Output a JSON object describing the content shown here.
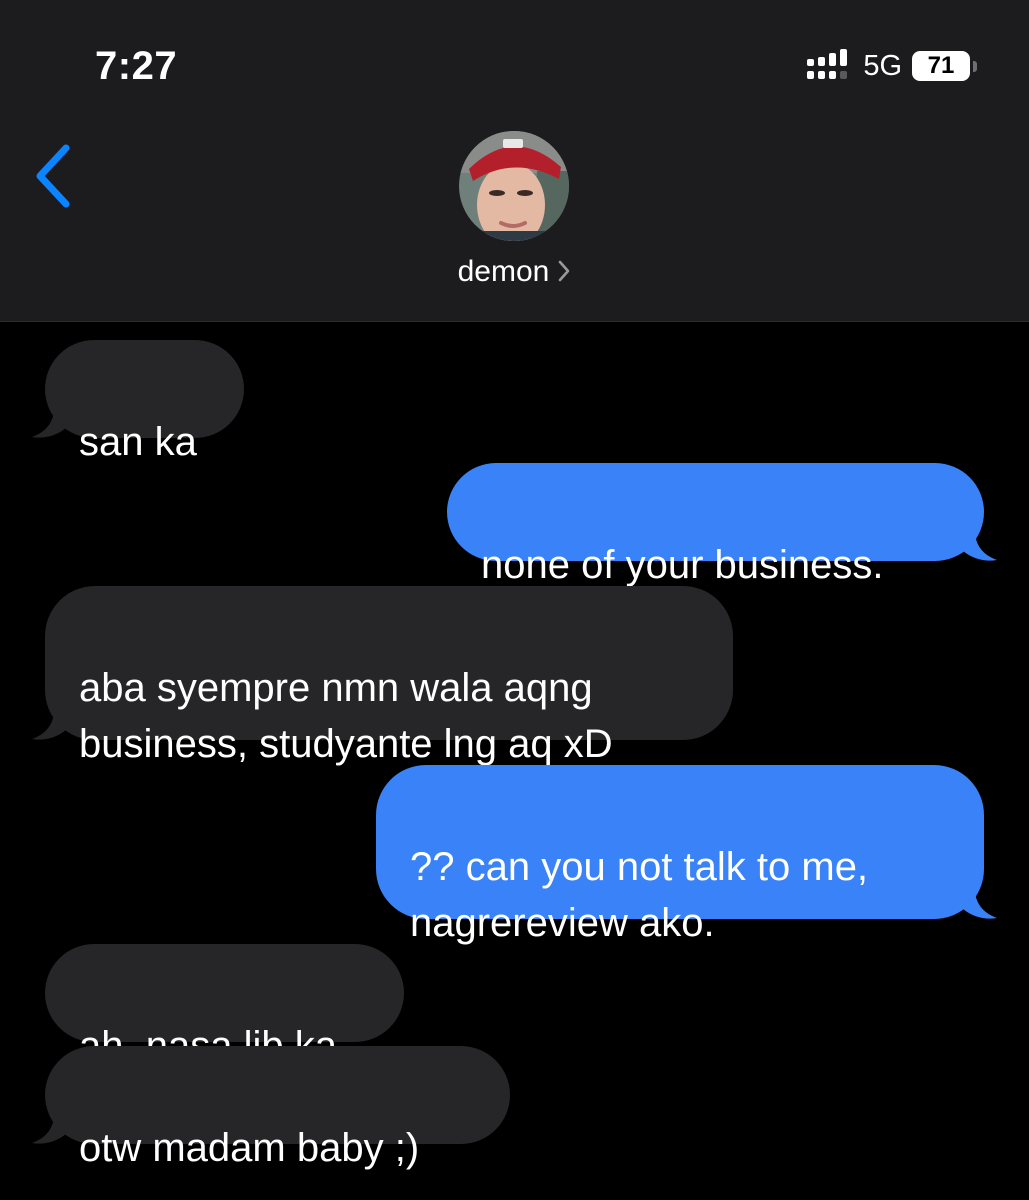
{
  "status_bar": {
    "time": "7:27",
    "network": "5G",
    "battery": "71"
  },
  "header": {
    "contact_name": "demon",
    "back_icon": "chevron-left-icon",
    "name_chevron_icon": "chevron-right-icon"
  },
  "colors": {
    "header_bg": "#1c1c1e",
    "background": "#000000",
    "received_bubble": "#262628",
    "sent_bubble": "#3a82f7",
    "accent": "#0a84ff"
  },
  "messages": [
    {
      "sender": "them",
      "text": "san ka"
    },
    {
      "sender": "me",
      "text": "none of your business."
    },
    {
      "sender": "them",
      "text": "aba syempre nmn wala aqng\nbusiness, studyante lng aq xD"
    },
    {
      "sender": "me",
      "text": "?? can you not talk to me,\nnagrereview ako."
    },
    {
      "sender": "them",
      "text": "ah, nasa lib ka"
    },
    {
      "sender": "them",
      "text": "otw madam baby ;)"
    }
  ]
}
